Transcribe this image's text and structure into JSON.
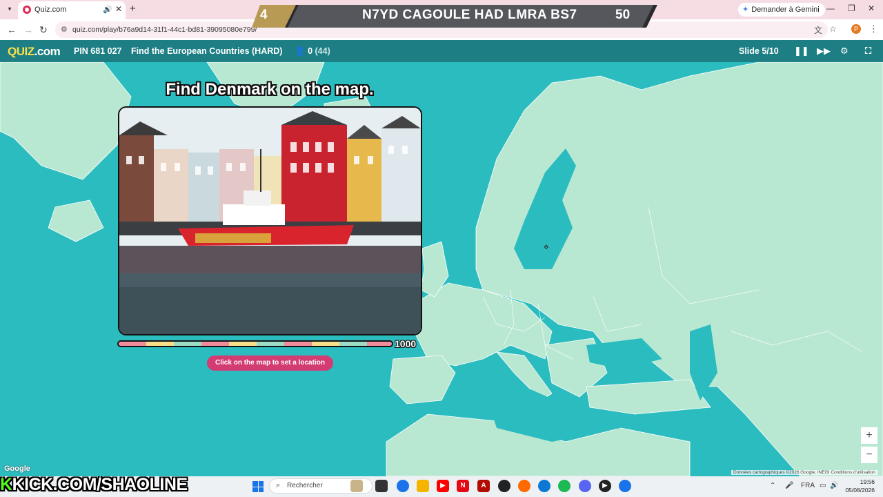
{
  "browser": {
    "tab_title": "Quiz.com",
    "url": "quiz.com/play/b76a9d14-31f1-44c1-bd81-39095080e799/",
    "gemini_button": "Demander à Gemini",
    "profile_initial": "P"
  },
  "stream_banner": {
    "rank": "4",
    "title": "N7YD CAGOULE HAD LMRA BS7",
    "score": "50"
  },
  "quiz_header": {
    "logo_main": "QUIZ",
    "logo_suffix": ".com",
    "pin": "PIN 681 027",
    "quiz_title": "Find the European Countries (HARD)",
    "answered": "0",
    "players": "(44)",
    "slide": "Slide 5/10"
  },
  "question": {
    "text": "Find Denmark on the map.",
    "image_alt": "Colorful harbour houses with a red ship",
    "timer_points": "1000",
    "timer_remaining": 1.0,
    "hint_button": "Click on the map to set a location"
  },
  "map": {
    "google_logo": "Google",
    "attribution": "Données cartographiques ©2026 Google, INEGI    Conditions d'utilisation",
    "zoom_in": "+",
    "zoom_out": "−"
  },
  "taskbar": {
    "stream_tag": "KICK.COM/SHAOLINE",
    "search_placeholder": "Rechercher",
    "language": "FRA",
    "time": "19:56",
    "date": "05/08/2026"
  },
  "colors": {
    "sea": "#2bbcc0",
    "land": "#b9e8d2",
    "header": "#196e73",
    "hint_button": "#d23c73",
    "banner_gold": "#b89a55"
  }
}
